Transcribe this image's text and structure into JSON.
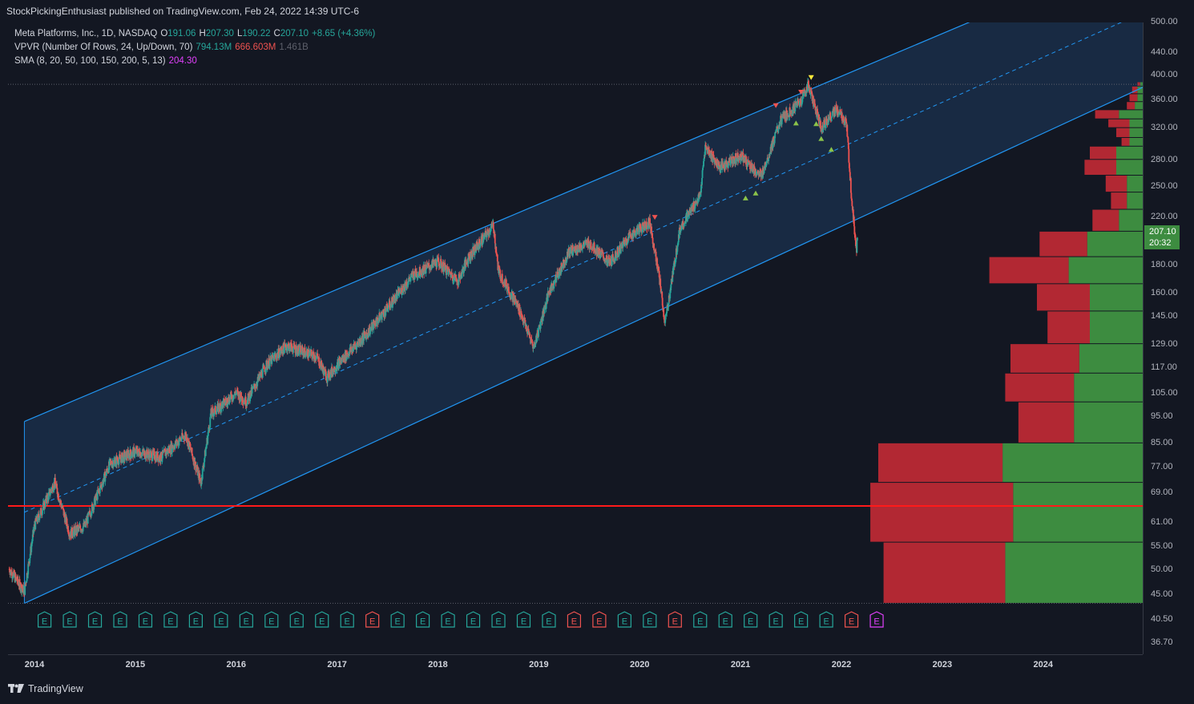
{
  "header": {
    "publisher": "StockPickingEnthusiast published on TradingView.com, Feb 24, 2022 14:39 UTC-6"
  },
  "legend": {
    "symbol": "Meta Platforms, Inc., 1D, NASDAQ",
    "o_key": "O",
    "o_val": "191.06",
    "h_key": "H",
    "h_val": "207.30",
    "l_key": "L",
    "l_val": "190.22",
    "c_key": "C",
    "c_val": "207.10",
    "change": "+8.65 (+4.36%)",
    "vpvr_label": "VPVR (Number Of Rows, 24, Up/Down, 70)",
    "vpvr_up": "794.13M",
    "vpvr_down": "666.603M",
    "vpvr_total": "1.461B",
    "sma_label": "SMA (8, 20, 50, 100, 150, 200, 5, 13)",
    "sma_val": "204.30"
  },
  "price_tag": {
    "price": "207.10",
    "time": "20:32"
  },
  "footer": {
    "brand": "TradingView"
  },
  "colors": {
    "background": "#131722",
    "channel_line": "#2196f3",
    "channel_fill": "#1e3a5f",
    "support_line": "#ff1a1a",
    "vp_up": "#3d8c40",
    "vp_down": "#b22833",
    "candle_up": "#26a69a",
    "candle_down": "#ef5350",
    "earnings_green": "#26a69a",
    "earnings_red": "#ef5350",
    "earnings_magenta": "#e040fb"
  },
  "chart_data": {
    "type": "candlestick",
    "y_scale": "log",
    "ylim": [
      34,
      520
    ],
    "xlim": [
      2013.75,
      2025.0
    ],
    "y_ticks": [
      "500.00",
      "440.00",
      "400.00",
      "360.00",
      "320.00",
      "280.00",
      "250.00",
      "220.00",
      "180.00",
      "160.00",
      "145.00",
      "129.00",
      "117.00",
      "105.00",
      "95.00",
      "85.00",
      "77.00",
      "69.00",
      "61.00",
      "55.00",
      "50.00",
      "45.00",
      "40.50",
      "36.70"
    ],
    "x_ticks": [
      "2014",
      "2015",
      "2016",
      "2017",
      "2018",
      "2019",
      "2020",
      "2021",
      "2022",
      "2023",
      "2024"
    ],
    "price_path": [
      [
        2013.75,
        50
      ],
      [
        2013.9,
        45.5
      ],
      [
        2014.0,
        60
      ],
      [
        2014.2,
        72
      ],
      [
        2014.35,
        58
      ],
      [
        2014.5,
        60
      ],
      [
        2014.75,
        78
      ],
      [
        2015.0,
        82
      ],
      [
        2015.25,
        80
      ],
      [
        2015.5,
        88
      ],
      [
        2015.65,
        72
      ],
      [
        2015.75,
        96
      ],
      [
        2016.0,
        105
      ],
      [
        2016.1,
        101
      ],
      [
        2016.3,
        118
      ],
      [
        2016.5,
        128
      ],
      [
        2016.8,
        122
      ],
      [
        2016.9,
        112
      ],
      [
        2017.0,
        118
      ],
      [
        2017.3,
        135
      ],
      [
        2017.5,
        150
      ],
      [
        2017.75,
        172
      ],
      [
        2018.0,
        182
      ],
      [
        2018.2,
        168
      ],
      [
        2018.3,
        185
      ],
      [
        2018.55,
        212
      ],
      [
        2018.6,
        175
      ],
      [
        2018.8,
        150
      ],
      [
        2018.95,
        127
      ],
      [
        2019.1,
        160
      ],
      [
        2019.3,
        190
      ],
      [
        2019.5,
        197
      ],
      [
        2019.7,
        181
      ],
      [
        2019.9,
        203
      ],
      [
        2020.1,
        215
      ],
      [
        2020.2,
        168
      ],
      [
        2020.25,
        140
      ],
      [
        2020.4,
        210
      ],
      [
        2020.6,
        240
      ],
      [
        2020.65,
        295
      ],
      [
        2020.8,
        270
      ],
      [
        2021.0,
        285
      ],
      [
        2021.2,
        260
      ],
      [
        2021.4,
        330
      ],
      [
        2021.6,
        358
      ],
      [
        2021.67,
        384
      ],
      [
        2021.8,
        320
      ],
      [
        2021.95,
        345
      ],
      [
        2022.05,
        325
      ],
      [
        2022.1,
        239
      ],
      [
        2022.15,
        190
      ],
      [
        2022.16,
        207.1
      ]
    ],
    "channel": {
      "upper": [
        [
          2013.9,
          93
        ],
        [
          2025.0,
          680
        ]
      ],
      "lower": [
        [
          2013.9,
          43.3
        ],
        [
          2025.0,
          380
        ]
      ],
      "mid": [
        [
          2013.9,
          63.5
        ],
        [
          2025.0,
          520
        ]
      ]
    },
    "support_level": 65.2,
    "dotted_levels": [
      384,
      43.3
    ],
    "volume_profile": [
      {
        "lo": 43.3,
        "hi": 56,
        "up": 0.52,
        "down": 0.46
      },
      {
        "lo": 56,
        "hi": 72,
        "up": 0.49,
        "down": 0.54
      },
      {
        "lo": 72,
        "hi": 85,
        "up": 0.53,
        "down": 0.47
      },
      {
        "lo": 85,
        "hi": 101,
        "up": 0.26,
        "down": 0.21
      },
      {
        "lo": 101,
        "hi": 114,
        "up": 0.26,
        "down": 0.26
      },
      {
        "lo": 114,
        "hi": 129,
        "up": 0.24,
        "down": 0.26
      },
      {
        "lo": 129,
        "hi": 148,
        "up": 0.2,
        "down": 0.16
      },
      {
        "lo": 148,
        "hi": 166,
        "up": 0.2,
        "down": 0.2
      },
      {
        "lo": 166,
        "hi": 186,
        "up": 0.28,
        "down": 0.3
      },
      {
        "lo": 186,
        "hi": 207,
        "up": 0.21,
        "down": 0.18
      },
      {
        "lo": 207,
        "hi": 227,
        "up": 0.09,
        "down": 0.1
      },
      {
        "lo": 227,
        "hi": 244,
        "up": 0.06,
        "down": 0.06
      },
      {
        "lo": 244,
        "hi": 262,
        "up": 0.06,
        "down": 0.08
      },
      {
        "lo": 262,
        "hi": 280,
        "up": 0.1,
        "down": 0.12
      },
      {
        "lo": 280,
        "hi": 296,
        "up": 0.1,
        "down": 0.1
      },
      {
        "lo": 296,
        "hi": 307,
        "up": 0.05,
        "down": 0.03
      },
      {
        "lo": 307,
        "hi": 320,
        "up": 0.05,
        "down": 0.05
      },
      {
        "lo": 320,
        "hi": 332,
        "up": 0.05,
        "down": 0.08
      },
      {
        "lo": 332,
        "hi": 345,
        "up": 0.09,
        "down": 0.09
      },
      {
        "lo": 345,
        "hi": 357,
        "up": 0.03,
        "down": 0.03
      },
      {
        "lo": 357,
        "hi": 369,
        "up": 0.02,
        "down": 0.03
      },
      {
        "lo": 369,
        "hi": 381,
        "up": 0.02,
        "down": 0.02
      },
      {
        "lo": 381,
        "hi": 388,
        "up": 0.01,
        "down": 0.01
      }
    ],
    "signals_down": [
      [
        2021.35,
        344
      ],
      [
        2021.6,
        364
      ],
      [
        2021.7,
        387
      ],
      [
        2020.15,
        215
      ]
    ],
    "signals_up": [
      [
        2021.05,
        243
      ],
      [
        2021.15,
        248
      ],
      [
        2021.55,
        333
      ],
      [
        2021.75,
        332
      ],
      [
        2021.8,
        312
      ],
      [
        2021.9,
        298
      ]
    ],
    "earnings": [
      {
        "x": 2014.1,
        "c": "g"
      },
      {
        "x": 2014.35,
        "c": "g"
      },
      {
        "x": 2014.6,
        "c": "g"
      },
      {
        "x": 2014.85,
        "c": "g"
      },
      {
        "x": 2015.1,
        "c": "g"
      },
      {
        "x": 2015.35,
        "c": "g"
      },
      {
        "x": 2015.6,
        "c": "g"
      },
      {
        "x": 2015.85,
        "c": "g"
      },
      {
        "x": 2016.1,
        "c": "g"
      },
      {
        "x": 2016.35,
        "c": "g"
      },
      {
        "x": 2016.6,
        "c": "g"
      },
      {
        "x": 2016.85,
        "c": "g"
      },
      {
        "x": 2017.1,
        "c": "g"
      },
      {
        "x": 2017.35,
        "c": "r"
      },
      {
        "x": 2017.6,
        "c": "g"
      },
      {
        "x": 2017.85,
        "c": "g"
      },
      {
        "x": 2018.1,
        "c": "g"
      },
      {
        "x": 2018.35,
        "c": "g"
      },
      {
        "x": 2018.6,
        "c": "g"
      },
      {
        "x": 2018.85,
        "c": "g"
      },
      {
        "x": 2019.1,
        "c": "g"
      },
      {
        "x": 2019.35,
        "c": "r"
      },
      {
        "x": 2019.6,
        "c": "r"
      },
      {
        "x": 2019.85,
        "c": "g"
      },
      {
        "x": 2020.1,
        "c": "g"
      },
      {
        "x": 2020.35,
        "c": "r"
      },
      {
        "x": 2020.6,
        "c": "g"
      },
      {
        "x": 2020.85,
        "c": "g"
      },
      {
        "x": 2021.1,
        "c": "g"
      },
      {
        "x": 2021.35,
        "c": "g"
      },
      {
        "x": 2021.6,
        "c": "g"
      },
      {
        "x": 2021.85,
        "c": "g"
      },
      {
        "x": 2022.1,
        "c": "r"
      },
      {
        "x": 2022.35,
        "c": "m"
      }
    ]
  }
}
